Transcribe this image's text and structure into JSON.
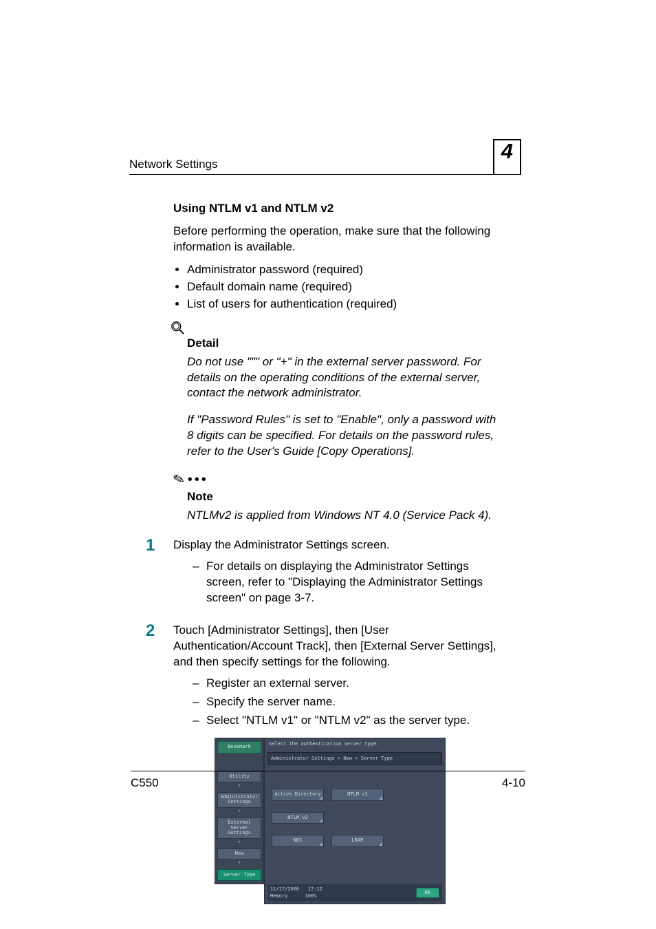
{
  "header": {
    "section": "Network Settings",
    "chapter": "4"
  },
  "content": {
    "h2": "Using NTLM v1 and NTLM v2",
    "intro": "Before performing the operation, make sure that the following information is available.",
    "prereq": [
      "Administrator password (required)",
      "Default domain name (required)",
      "List of users for authentication (required)"
    ],
    "detail": {
      "title": "Detail",
      "p1": "Do not use \"\"\" or \"+\" in the external server password. For details on the operating conditions of the external server, contact the network administrator.",
      "p2": "If \"Password Rules\" is set to \"Enable\", only a password with 8 digits can be specified. For details on the password rules, refer to the User's Guide [Copy Operations]."
    },
    "note": {
      "title": "Note",
      "body": "NTLMv2 is applied from Windows NT 4.0 (Service Pack 4)."
    },
    "steps": {
      "s1": {
        "num": "1",
        "text": "Display the Administrator Settings screen.",
        "sub": [
          "For details on displaying the Administrator Settings screen, refer to \"Displaying the Administrator Settings screen\" on page 3-7."
        ]
      },
      "s2": {
        "num": "2",
        "text": "Touch [Administrator Settings], then [User Authentication/Account Track], then [External Server Settings], and then specify settings for the following.",
        "sub": [
          "Register an external server.",
          "Specify the server name.",
          "Select \"NTLM v1\" or \"NTLM v2\" as the server type."
        ]
      }
    }
  },
  "ui": {
    "bookmark": "Bookmark",
    "nav": {
      "utility": "Utility",
      "admin": "Administrator Settings",
      "ext": "External Server Settings",
      "new": "New",
      "server_type": "Server Type"
    },
    "header_text": "Select the authentication server type.",
    "breadcrumb": "Administrator Settings > New > Server Type",
    "options": {
      "ad": "Active Directory",
      "ntlm1": "NTLM v1",
      "ntlm2": "NTLM v2",
      "nds": "NDS",
      "ldap": "LDAP"
    },
    "status": {
      "date": "11/17/2006",
      "time": "17:12",
      "mem_label": "Memory",
      "mem_val": "100%"
    },
    "ok": "OK"
  },
  "footer": {
    "model": "C550",
    "page": "4-10"
  }
}
